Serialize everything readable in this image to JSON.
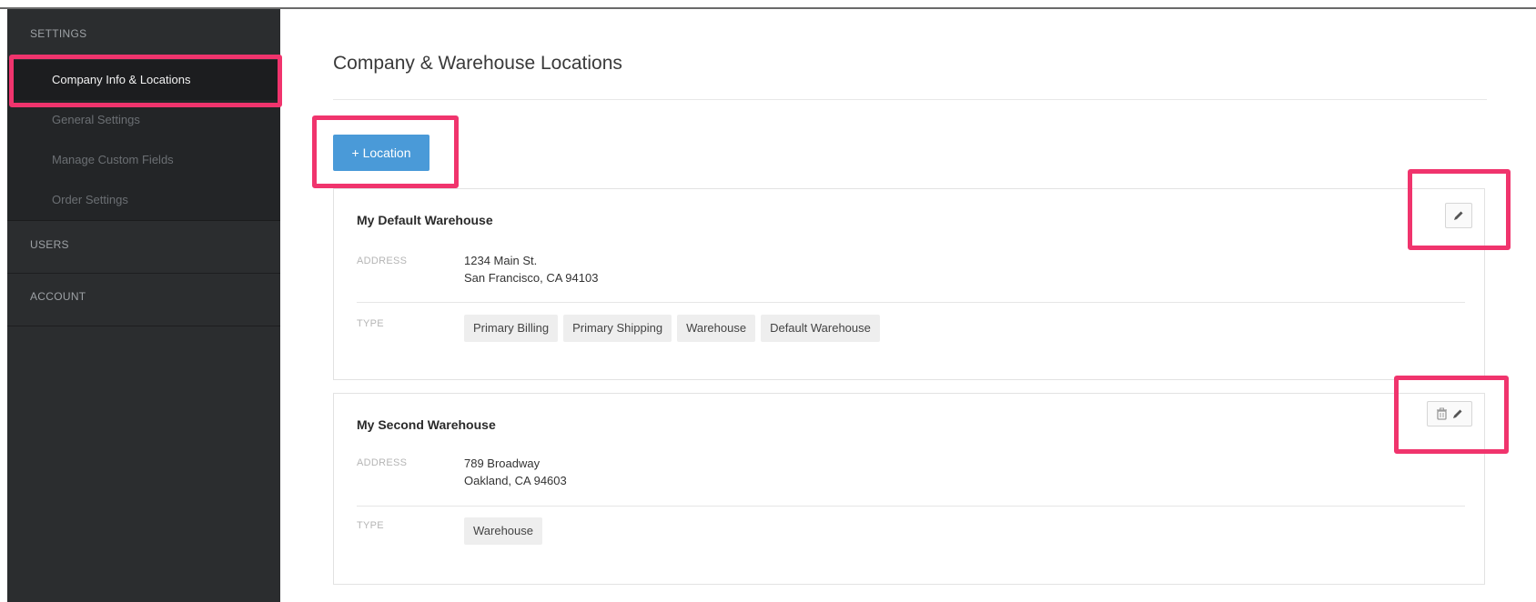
{
  "sidebar": {
    "sections": [
      {
        "label": "SETTINGS"
      },
      {
        "label": "USERS"
      },
      {
        "label": "ACCOUNT"
      }
    ],
    "settings_items": [
      {
        "label": "Company Info & Locations",
        "active": true
      },
      {
        "label": "General Settings"
      },
      {
        "label": "Manage Custom Fields"
      },
      {
        "label": "Order Settings"
      }
    ]
  },
  "main": {
    "title": "Company & Warehouse Locations",
    "add_button_label": "+ Location",
    "locations": [
      {
        "name": "My Default Warehouse",
        "address_label": "ADDRESS",
        "address_lines": [
          "1234 Main St.",
          "San Francisco, CA 94103"
        ],
        "type_label": "TYPE",
        "types": [
          "Primary Billing",
          "Primary Shipping",
          "Warehouse",
          "Default Warehouse"
        ],
        "actions": [
          "edit"
        ]
      },
      {
        "name": "My Second Warehouse",
        "address_label": "ADDRESS",
        "address_lines": [
          "789 Broadway",
          "Oakland, CA 94603"
        ],
        "type_label": "TYPE",
        "types": [
          "Warehouse"
        ],
        "actions": [
          "delete",
          "edit"
        ]
      }
    ]
  },
  "colors": {
    "sidebar_bg": "#2b2d2f",
    "accent_button": "#4a9ad8",
    "highlight": "#f0346d"
  },
  "icons": [
    "pencil-icon",
    "trash-icon"
  ]
}
